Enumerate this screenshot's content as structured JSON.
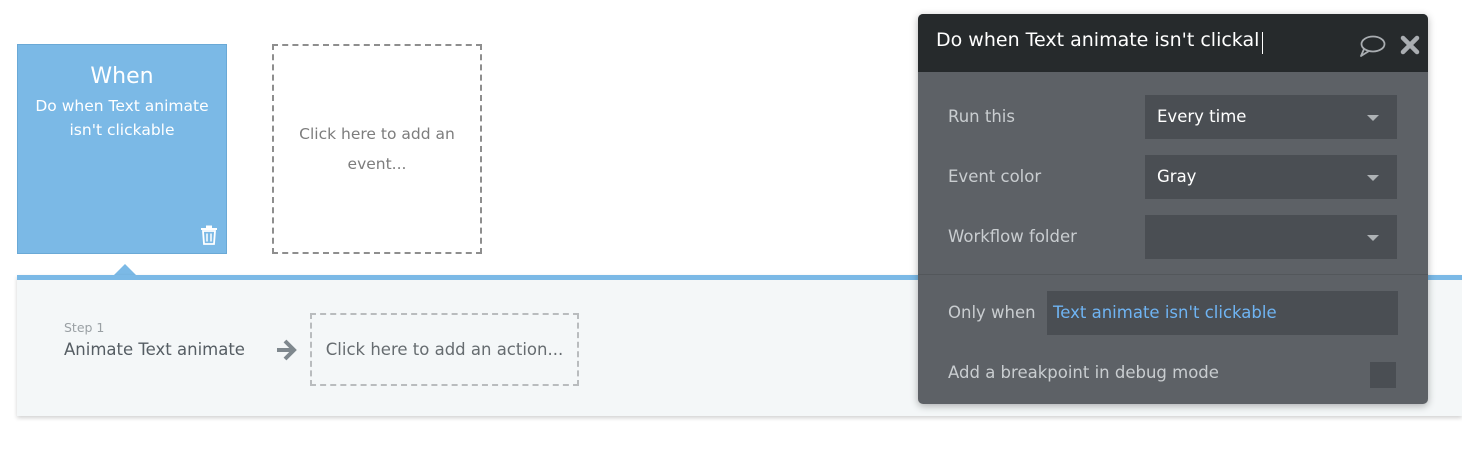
{
  "event": {
    "heading": "When",
    "name": "Do when Text animate isn't clickable",
    "add_event_text": "Click here to add an event..."
  },
  "actions": {
    "step_label": "Step 1",
    "step_title": "Animate Text animate",
    "add_action_text": "Click here to add an action..."
  },
  "panel": {
    "title": "Do when Text animate isn't clickal",
    "run_this": {
      "label": "Run this",
      "value": "Every time"
    },
    "event_color": {
      "label": "Event color",
      "value": "Gray"
    },
    "workflow_folder": {
      "label": "Workflow folder",
      "value": ""
    },
    "only_when": {
      "label": "Only when",
      "value": "Text animate isn't clickable"
    },
    "breakpoint": {
      "label": "Add a breakpoint in debug mode",
      "checked": false
    }
  },
  "icons": {
    "trash": "trash-icon",
    "arrow": "arrow-right-icon",
    "comment": "comment-icon",
    "close": "close-icon"
  },
  "colors": {
    "event_card": "#7bb9e6",
    "panel_bg": "#5d6166",
    "panel_header": "#262a2c",
    "expression_text": "#6fb4f3"
  }
}
